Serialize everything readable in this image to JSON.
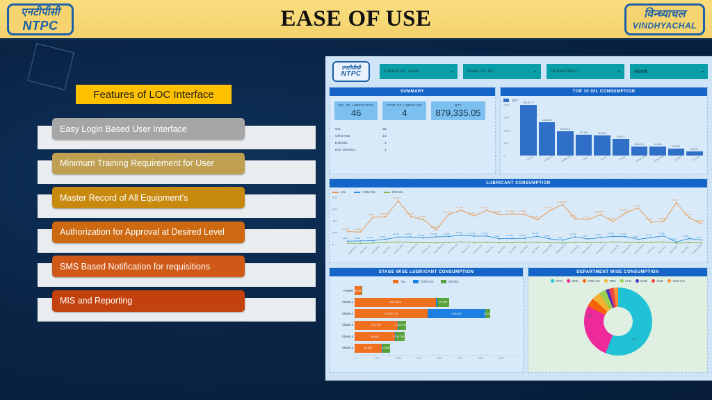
{
  "header": {
    "title": "EASE OF USE",
    "logo_left": {
      "hindi": "एनटीपीसी",
      "latin": "NTPC"
    },
    "logo_right": {
      "hindi": "विन्ध्याचल",
      "latin": "VINDHYACHAL"
    }
  },
  "features": {
    "title": "Features of LOC Interface",
    "items": [
      {
        "label": "Easy Login Based User Interface",
        "color": "#a6a6a6"
      },
      {
        "label": "Minimum Training Requirement for User",
        "color": "#bf9f52"
      },
      {
        "label": "Master Record of All Equipment's",
        "color": "#c8890f"
      },
      {
        "label": "Authorization for Approval at Desired Level",
        "color": "#cd6a11"
      },
      {
        "label": "SMS Based Notification for requisitions",
        "color": "#cf5a18"
      },
      {
        "label": "MIS and Reporting",
        "color": "#c2410c"
      }
    ]
  },
  "dashboard": {
    "logo": {
      "hindi": "एनटीपीसी",
      "latin": "NTPC"
    },
    "filters": [
      {
        "label": "FINANCIAL YEAR",
        "caret": "▾"
      },
      {
        "label": "NAME OF OIL",
        "caret": "▾"
      },
      {
        "label": "DEPARTMENT",
        "caret": "▾"
      },
      {
        "label": "Month",
        "caret": "▾"
      }
    ],
    "summary": {
      "title": "SUMMARY",
      "kpis": [
        {
          "label": "NO. OF LUBRICANTS",
          "value": "46"
        },
        {
          "label": "TYPE OF LUBRICANT",
          "value": "4"
        },
        {
          "label": "QTY",
          "value": "879,335.05"
        }
      ],
      "rows": [
        {
          "name": "OIL",
          "value": "38"
        },
        {
          "name": "GREASE",
          "value": "13"
        },
        {
          "name": "DIESEL",
          "value": "1"
        },
        {
          "name": "BIO DIESEL",
          "value": "1"
        }
      ]
    },
    "top10": {
      "title": "TOP 10 OIL CONSUMPTION"
    },
    "lubricant": {
      "title": "LUBRICANT CONSUMPTION"
    },
    "stage": {
      "title": "STAGE WISE LUBRICANT CONSUMPTION"
    },
    "department": {
      "title": "DEPARTMENT WISE CONSUMPTION"
    }
  },
  "chart_data": [
    {
      "type": "bar",
      "title": "TOP 10 OIL CONSUMPTION",
      "legend": [
        "QTY"
      ],
      "legend_position": "top-left",
      "categories": [
        "SP-46",
        "STMO-46",
        "SKMP-220",
        "HSD",
        "SP-32",
        "SP-68",
        "SKMP-460",
        "SKMP-680",
        "SS-460",
        "SS-121"
      ],
      "values": [
        198877.3,
        130230,
        96817.5,
        82196,
        80316,
        64611,
        35841.5,
        34560,
        26560,
        16571
      ],
      "value_labels": [
        "198,877.3",
        "130,230",
        "96,817.5",
        "82,196",
        "80,316",
        "64,611",
        "35,841.5",
        "34,560",
        "26,560",
        "16,571"
      ],
      "ylabel": "",
      "xlabel": "",
      "yticks": [
        "0",
        "50K",
        "100K",
        "150K",
        "200K"
      ],
      "ylim": [
        0,
        200000
      ],
      "grid": true,
      "color": "#2f6fc7"
    },
    {
      "type": "line",
      "title": "LUBRICANT CONSUMPTION",
      "legend_position": "top-left",
      "yticks": [
        "0",
        "20K",
        "40K",
        "60K",
        "80K"
      ],
      "ylim": [
        0,
        80000
      ],
      "grid": true,
      "x": [
        "April 2021",
        "May 2021",
        "June 2021",
        "July 2021",
        "August 2021",
        "September 21",
        "October 21",
        "November 21",
        "December 21",
        "January 22",
        "February 22",
        "March 22",
        "April 2022",
        "June 2022",
        "June 2022",
        "July 2022",
        "August 2022",
        "September 22",
        "October 22",
        "November 22",
        "December 22",
        "January 23",
        "February 23",
        "March 2023",
        "April 2023",
        "May 2023",
        "June 2023",
        "July 2023",
        "August 2023"
      ],
      "series": [
        {
          "name": "OIL",
          "color": "#ed9040",
          "values": [
            21605,
            20996,
            45983,
            46928,
            73735.5,
            47534.5,
            41932.5,
            24877.5,
            51127.5,
            57796,
            48441,
            57702,
            50710,
            51624.5,
            51286,
            41996,
            57496,
            67586.05,
            43908,
            41794.5,
            50639.5,
            38699.5,
            53916.5,
            61656.5,
            37764,
            39096.5,
            70614,
            45472.3,
            34985.5
          ],
          "value_labels": [
            "21,605",
            "20,996",
            "45,983",
            "46,928",
            "73,735.5",
            "47,534.5",
            "41,932.5",
            "24,877.5",
            "51,127.5",
            "57,796",
            "48,441",
            "57,702",
            "50,710",
            "51,624.5",
            "51,286",
            "41,996",
            "57,496",
            "67,586.05",
            "43,908",
            "41,794.5",
            "50,639.5",
            "38,699.5",
            "53,916.5",
            "61,656.5",
            "37,764",
            "39,096.5",
            "70,614",
            "45,472.3",
            "34,985.5"
          ]
        },
        {
          "name": "GREASE",
          "color": "#2f8fd8",
          "values": [
            5489,
            5991,
            6590,
            8755,
            12637,
            12667,
            11175,
            12904,
            13421,
            15920,
            14189,
            14300,
            9760,
            10160,
            10480,
            13782,
            9568,
            7310,
            12797,
            9317,
            11487,
            13937,
            13351,
            8590,
            11791,
            14528,
            4261,
            9981,
            7510
          ],
          "value_labels": [
            "5,489",
            "5,991",
            "6,590",
            "8,755",
            "12,637",
            "12,667",
            "11,175",
            "12,904",
            "13,421",
            "15,920",
            "14,189",
            "14,300",
            "9,760",
            "10,160",
            "10,480",
            "13,782",
            "9,568",
            "7,310",
            "12,797",
            "9,317",
            "11,487",
            "13,937",
            "13,351",
            "8,590",
            "11,791",
            "14,528",
            "4,261",
            "9,981",
            "7,510"
          ]
        },
        {
          "name": "DIESEL",
          "color": "#85b74f",
          "values": [
            2100,
            1900,
            2600,
            3100,
            4100,
            3300,
            2900,
            2700,
            3300,
            4200,
            3200,
            3600,
            2800,
            3100,
            3300,
            3900,
            2900,
            2600,
            3600,
            2800,
            3400,
            4000,
            3700,
            2900,
            3500,
            4100,
            2200,
            3100,
            2600
          ],
          "value_labels": []
        }
      ]
    },
    {
      "type": "bar",
      "orientation": "horizontal",
      "stacked": true,
      "title": "STAGE WISE LUBRICANT CONSUMPTION",
      "categories": [
        "HYDRO",
        "STAGE-1",
        "STAGE-2",
        "STAGE-3",
        "STAGE-4",
        "STAGE-5"
      ],
      "series": [
        {
          "name": "OIL",
          "color": "#f07020",
          "values": [
            16260,
            195234.8,
            174511.75,
            102705,
            96943,
            64940
          ],
          "value_labels": [
            "16,260",
            "195,234.8",
            "174,511.75",
            "102,705",
            "96,943",
            "64,940"
          ]
        },
        {
          "name": "GREASE",
          "color": "#1d7fe0",
          "values": [
            800,
            2500,
            138816,
            2368,
            1785,
            1200
          ],
          "value_labels": [
            "",
            "",
            "138,816",
            "2,368",
            "1,785",
            ""
          ]
        },
        {
          "name": "DIESEL",
          "color": "#5aa33c",
          "values": [
            1200,
            29468,
            12014,
            19193,
            20736,
            18566
          ],
          "value_labels": [
            "",
            "29,468",
            "12,014",
            "19,193",
            "20,736",
            "18,566"
          ]
        }
      ],
      "xticks": [
        "0",
        "50K",
        "100K",
        "150K",
        "200K",
        "250K",
        "300K",
        "350K"
      ],
      "xlim": [
        0,
        350000
      ],
      "grid": true
    },
    {
      "type": "pie",
      "subtype": "donut",
      "title": "DEPARTMENT WISE CONSUMPTION",
      "legend_position": "top",
      "labels": [
        "OPN",
        "BMD",
        "TMD-OS",
        "TMD",
        "AHD",
        "EMD",
        "TMD",
        "TMD-OS"
      ],
      "colors": [
        "#21c2d6",
        "#ee2a9a",
        "#f5620a",
        "#f2b130",
        "#9dcf4e",
        "#4b2fc4",
        "#ef4444",
        "#f78f3a"
      ],
      "values": [
        56,
        26.5,
        4.2,
        4.0,
        3.3,
        1.6,
        2.2,
        2.2
      ],
      "slice_labels": [
        "OPN",
        "BMD",
        "",
        "",
        "",
        "",
        "",
        ""
      ]
    }
  ]
}
